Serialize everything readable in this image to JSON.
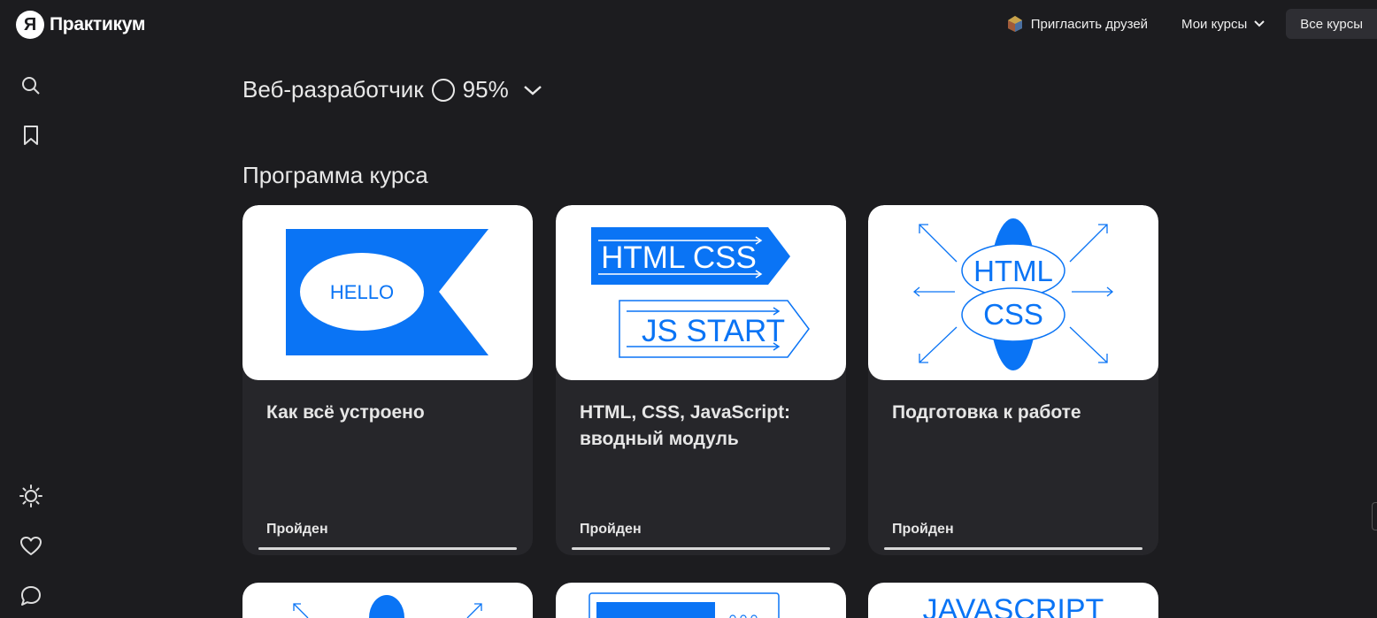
{
  "header": {
    "logo_mark": "Я",
    "logo_text": "Практикум",
    "invite_label": "Пригласить друзей",
    "my_courses_label": "Мои курсы",
    "all_courses_label": "Все курсы"
  },
  "course": {
    "title": "Веб-разработчик",
    "progress_label": "95%",
    "progress": 0.95
  },
  "program": {
    "section_title": "Программа курса",
    "modules": [
      {
        "title": "Как всё устроено",
        "status": "Пройден",
        "image_text": [
          "HELLO"
        ]
      },
      {
        "title": "HTML, CSS, JavaScript: вводный модуль",
        "status": "Пройден",
        "image_text": [
          "HTML CSS",
          "JS START"
        ]
      },
      {
        "title": "Подготовка к работе",
        "status": "Пройден",
        "image_text": [
          "HTML",
          "CSS"
        ]
      }
    ],
    "next_row_image_text": [
      "JAVASCRIPT"
    ]
  },
  "colors": {
    "background": "#1c1c1f",
    "card": "#26262a",
    "accent_blue": "#0a74f5"
  },
  "icons": [
    "search-icon",
    "bookmark-icon",
    "sun-icon",
    "heart-icon",
    "chat-icon",
    "chevron-down-icon"
  ]
}
